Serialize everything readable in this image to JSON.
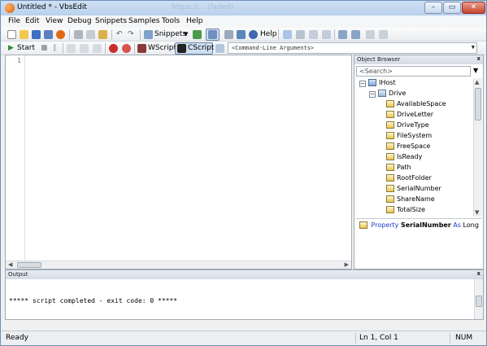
{
  "window": {
    "title": "Untitled * - VbsEdit",
    "ghost_url": "https://... (faded)"
  },
  "menu": [
    "File",
    "Edit",
    "View",
    "Debug",
    "Snippets",
    "Samples",
    "Tools",
    "Help"
  ],
  "toolbar1": {
    "snippets_label": "Snippets",
    "help_label": "Help"
  },
  "toolbar2": {
    "start_label": "Start",
    "wscript_label": "WScript",
    "cscript_label": "CScript",
    "args_placeholder": "<Command-Line Arguments>"
  },
  "editor": {
    "line_numbers": [
      "1"
    ]
  },
  "object_browser": {
    "title": "Object Browser",
    "close": "x",
    "search_placeholder": "<Search>",
    "tree": {
      "root": "IHost",
      "child": "Drive",
      "properties": [
        "AvailableSpace",
        "DriveLetter",
        "DriveType",
        "FileSystem",
        "FreeSpace",
        "IsReady",
        "Path",
        "RootFolder",
        "SerialNumber",
        "ShareName",
        "TotalSize"
      ]
    },
    "description": {
      "kind": "Property",
      "name": "SerialNumber",
      "as": "As",
      "type": "Long"
    }
  },
  "output": {
    "title": "Output",
    "close": "x",
    "text": "***** script completed - exit code: 0 *****"
  },
  "status": {
    "left": "Ready",
    "position": "Ln 1, Col 1",
    "mode": "NUM"
  },
  "colors": {
    "title_gradient_top": "#cfe0f4",
    "title_gradient_bottom": "#b9d0ec",
    "keyword_blue": "#1f3ccc",
    "close_button": "#c7432c"
  }
}
